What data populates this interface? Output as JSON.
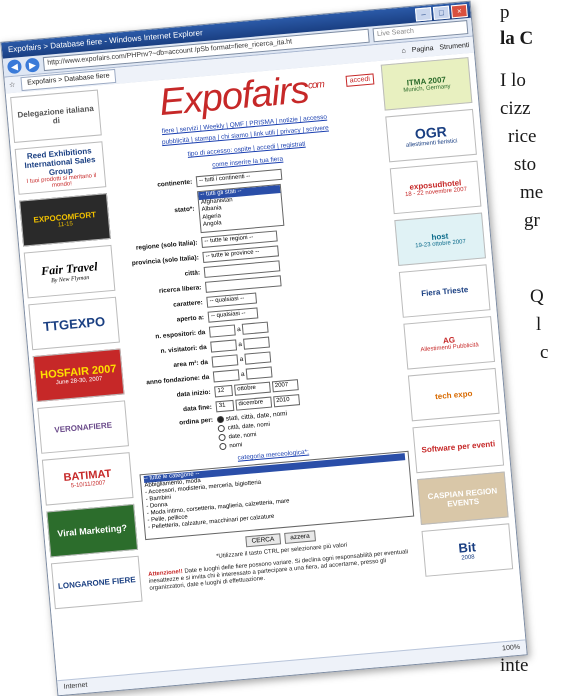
{
  "magazine": {
    "lines": [
      "p",
      "la C",
      "I lo",
      "cizz",
      "rice",
      "sto",
      "me",
      "gr",
      "Q",
      "l",
      "c",
      "inte"
    ]
  },
  "window": {
    "title": "Expofairs > Database fiere - Windows Internet Explorer",
    "address": "http://www.expofairs.com/PHPnv?~db=account /pSb format=fiere_ricerca_ita.ht",
    "search_placeholder": "Live Search",
    "tab_label": "Expofairs > Database fiere",
    "toolbar_items": [
      "Pagina",
      "Strumenti"
    ],
    "status": "Internet",
    "zoom": "100%"
  },
  "left_banners": [
    {
      "title": "Delegazione italiana di",
      "sub": ""
    },
    {
      "title": "Reed Exhibitions International Sales Group",
      "sub": "I tuoi prodotti si meritano il mondo!"
    },
    {
      "title": "EXPOCOMFORT",
      "sub": "11-15"
    },
    {
      "title": "Fair Travel",
      "sub": "By New Flyman"
    },
    {
      "title": "TTGEXPO",
      "sub": ""
    },
    {
      "title": "HOSFAIR 2007",
      "sub": "June 28-30, 2007"
    },
    {
      "title": "VERONAFIERE",
      "sub": ""
    },
    {
      "title": "BATIMAT",
      "sub": "5-10/11/2007"
    },
    {
      "title": "Viral Marketing?",
      "sub": ""
    },
    {
      "title": "LONGARONE FIERE",
      "sub": ""
    }
  ],
  "right_banners": [
    {
      "title": "ITMA 2007",
      "sub": "Munich, Germany"
    },
    {
      "title": "OGR",
      "sub": "allestimenti fieristici"
    },
    {
      "title": "exposudhotel",
      "sub": "18 - 22 novembre 2007"
    },
    {
      "title": "host",
      "sub": "19-23 ottobre 2007"
    },
    {
      "title": "Fiera Trieste",
      "sub": ""
    },
    {
      "title": "AG",
      "sub": "Allestimenti Pubblicità"
    },
    {
      "title": "tech expo",
      "sub": ""
    },
    {
      "title": "Software per eventi",
      "sub": ""
    },
    {
      "title": "CASPIAN REGION EVENTS",
      "sub": ""
    },
    {
      "title": "Bit",
      "sub": "2008"
    }
  ],
  "site": {
    "logo": "Expofairs",
    "logo_suffix": "com",
    "login_button": "accedi",
    "menu_line1": "fiere | servizi | Weekly | QMF | PRISMA | notizie | accesso",
    "menu_line2": "pubblicità | stampa | chi siamo | link utili | privacy | scrivere",
    "access_link": "tipo di accesso: ospite | accedi | registrati",
    "insert_link": "come inserire la tua fiera"
  },
  "form": {
    "continent_label": "continente:",
    "continent_value": "-- tutti i continenti --",
    "state_label": "stato*:",
    "state_options": [
      "-- tutti gli stati --",
      "Afghanistan",
      "Albania",
      "Algeria",
      "Angola"
    ],
    "region_label": "regione (solo Italia):",
    "region_value": "-- tutte le regioni --",
    "province_label": "provincia (solo Italia):",
    "province_value": "-- tutte le province --",
    "city_label": "città:",
    "search_label": "ricerca libera:",
    "character_label": "carattere:",
    "character_value": "-- qualsiasi --",
    "open_label": "aperto a:",
    "open_value": "-- qualsiasi --",
    "exhibitors_label": "n. espositori: da",
    "visitors_label": "n. visitatori: da",
    "area_label": "area m²: da",
    "founded_label": "anno fondazione: da",
    "start_label": "data inizio:",
    "start_day": "12",
    "start_month": "ottobre",
    "start_year": "2007",
    "end_label": "data fine:",
    "end_day": "31",
    "end_month": "dicembre",
    "end_year": "2010",
    "order_label": "ordina per:",
    "order_options": [
      "stati, città, date, nomi",
      "città, date, nomi",
      "date, nomi",
      "nomi"
    ],
    "category_link": "categoria merceologica*:",
    "categories": [
      "-- tutte le categorie --",
      "Abbigliamento, moda",
      "- Accessori, modisteria, merceria, bigiotteria",
      "- Bambini",
      "- Donna",
      "- Moda intimo, corsetteria, maglieria, calzetteria, mare",
      "- Pelle, pellicce",
      "- Pelletteria, calzature, macchinari per calzature"
    ],
    "search_button": "CERCA",
    "reset_button": "azzera",
    "note": "*Utilizzare il tasto CTRL per selezionare più valori",
    "attention_label": "Attenzione!!",
    "attention_text": "Date e luoghi delle fiere possono variare. Si declina ogni responsabilità per eventuali inesattezze e si invita chi è interessato a partecipare a una fiera, ad accertarne, presso gli organizzatori, date e luoghi di effettuazione."
  }
}
